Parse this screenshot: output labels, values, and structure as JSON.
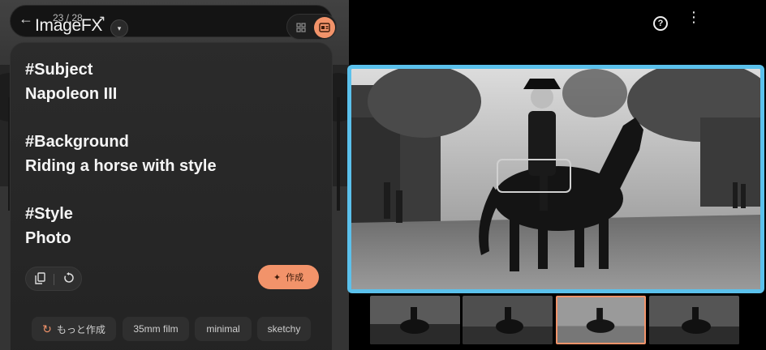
{
  "header": {
    "app_title": "ImageFX",
    "counter": "23 / 28",
    "dropdown_icon": "chevron-down-icon",
    "back_icon": "arrow-left-icon",
    "forward_icon": "arrow-right-icon",
    "view_grid_icon": "grid-icon",
    "view_single_icon": "single-image-icon"
  },
  "prompt": {
    "subject_tag": "#Subject",
    "subject_value": "Napoleon III",
    "background_tag": "#Background",
    "background_value": "Riding a horse with style",
    "style_tag": "#Style",
    "style_value": "Photo"
  },
  "toolbar": {
    "copy_icon": "copy-icon",
    "reset_icon": "reset-icon",
    "create_label": "作成",
    "create_icon": "sparkle-icon"
  },
  "chips": [
    {
      "label": "もっと作成",
      "icon": "refresh-icon"
    },
    {
      "label": "35mm film"
    },
    {
      "label": "minimal"
    },
    {
      "label": "sketchy"
    }
  ],
  "top_right": {
    "help_icon": "help-icon",
    "more_icon": "more-vert-icon"
  },
  "thumbnails": {
    "count": 4,
    "selected_index": 2
  },
  "colors": {
    "accent": "#f2936a",
    "selection_border": "#5bc1ec",
    "panel_bg": "#262626"
  }
}
